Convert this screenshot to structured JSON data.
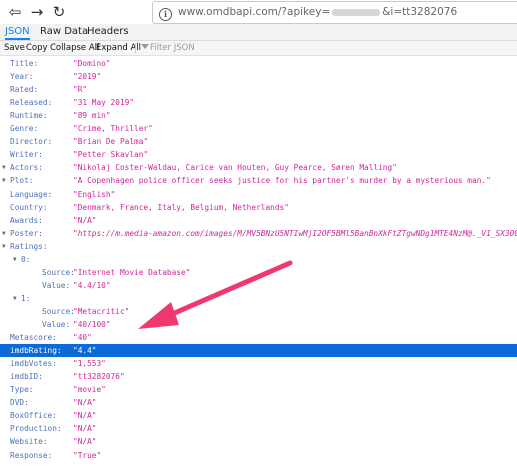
{
  "nav": {
    "back_glyph": "⇦",
    "forward_glyph": "→",
    "reload_glyph": "↻"
  },
  "address_bar": {
    "url_prefix": "www.omdbapi.com/?apikey=",
    "url_suffix": "&i=tt3282076",
    "icon": "info-icon"
  },
  "tabs": [
    {
      "label": "JSON",
      "active": true
    },
    {
      "label": "Raw Data",
      "active": false
    },
    {
      "label": "Headers",
      "active": false
    }
  ],
  "toolbar": {
    "save": "Save",
    "copy": "Copy",
    "collapse_all": "Collapse All",
    "expand_all": "Expand All",
    "filter_placeholder": "Filter JSON"
  },
  "json_rows": [
    {
      "key": "Title:",
      "value": "\"Domino\""
    },
    {
      "key": "Year:",
      "value": "\"2019\""
    },
    {
      "key": "Rated:",
      "value": "\"R\""
    },
    {
      "key": "Released:",
      "value": "\"31 May 2019\""
    },
    {
      "key": "Runtime:",
      "value": "\"89 min\""
    },
    {
      "key": "Genre:",
      "value": "\"Crime, Thriller\""
    },
    {
      "key": "Director:",
      "value": "\"Brian De Palma\""
    },
    {
      "key": "Writer:",
      "value": "\"Petter Skavlan\""
    },
    {
      "key": "Actors:",
      "value": "\"Nikolaj Coster-Waldau, Carice van Houten, Guy Pearce, Søren Malling\"",
      "twisty": true
    },
    {
      "key": "Plot:",
      "value": "\"A Copenhagen police officer seeks justice for his partner's murder by a mysterious man.\"",
      "twisty": true
    },
    {
      "key": "Language:",
      "value": "\"English\""
    },
    {
      "key": "Country:",
      "value": "\"Denmark, France, Italy, Belgium, Netherlands\""
    },
    {
      "key": "Awards:",
      "value": "\"N/A\""
    },
    {
      "key": "Poster:",
      "value": "\"https://m.media-amazon.com/images/M/MV5BNzU5NTIwMjI2OF5BMl5BanBnXkFtZTgwNDg1MTE4NzM@._V1_SX300.jpg\"",
      "twisty": true,
      "url": true
    },
    {
      "key": "Ratings:",
      "value": "",
      "twisty": true
    },
    {
      "key": "0:",
      "value": "",
      "twisty": true,
      "indent": 1
    },
    {
      "key": "Source:",
      "value": "\"Internet Movie Database\"",
      "indent": 2
    },
    {
      "key": "Value:",
      "value": "\"4.4/10\"",
      "indent": 2
    },
    {
      "key": "1:",
      "value": "",
      "twisty": true,
      "indent": 1
    },
    {
      "key": "Source:",
      "value": "\"Metacritic\"",
      "indent": 2
    },
    {
      "key": "Value:",
      "value": "\"40/100\"",
      "indent": 2
    },
    {
      "key": "Metascore:",
      "value": "\"40\""
    },
    {
      "key": "imdbRating:",
      "value": "\"4.4\"",
      "highlighted": true
    },
    {
      "key": "imdbVotes:",
      "value": "\"1,553\""
    },
    {
      "key": "imdbID:",
      "value": "\"tt3282076\""
    },
    {
      "key": "Type:",
      "value": "\"movie\""
    },
    {
      "key": "DVD:",
      "value": "\"N/A\""
    },
    {
      "key": "BoxOffice:",
      "value": "\"N/A\""
    },
    {
      "key": "Production:",
      "value": "\"N/A\""
    },
    {
      "key": "Website:",
      "value": "\"N/A\""
    },
    {
      "key": "Response:",
      "value": "\"True\""
    }
  ],
  "colors": {
    "key": "#4e72b5",
    "value": "#d0269a",
    "highlight": "#0b6ad8",
    "annotation_arrow": "#f0386f",
    "active_tab": "#0a84ff"
  }
}
